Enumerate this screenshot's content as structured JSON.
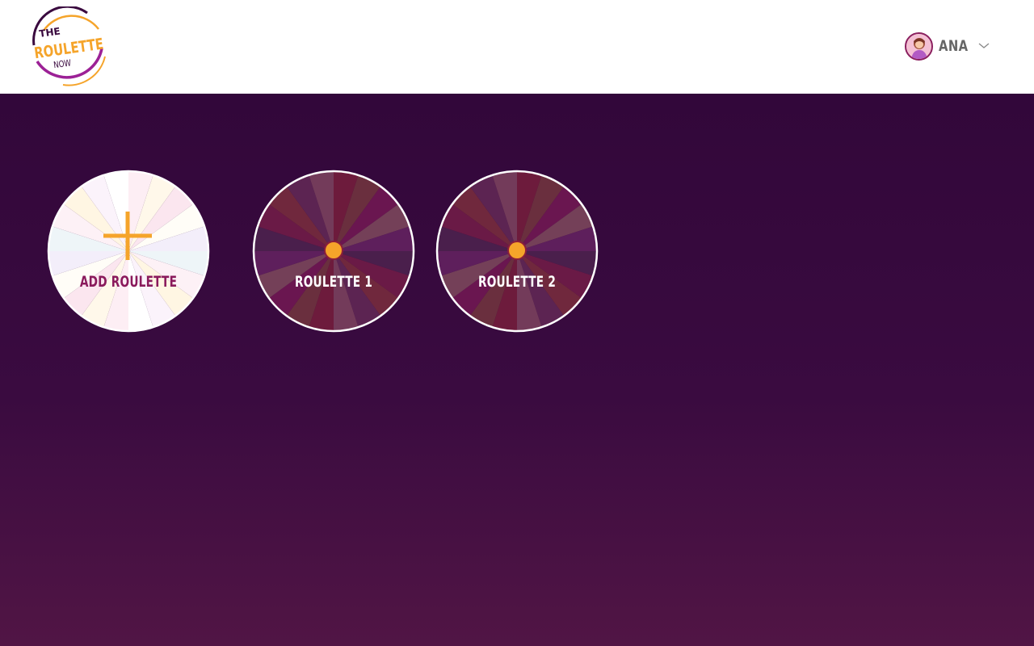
{
  "header": {
    "logo": {
      "line1": "THE",
      "line2": "ROULETTE",
      "line3": "NOW"
    },
    "user": {
      "name": "ANA",
      "avatar_icon": "user-avatar-icon",
      "menu_icon": "chevron-down-icon"
    }
  },
  "roulettes": {
    "add": {
      "label": "ADD ROULETTE",
      "icon": "plus-icon"
    },
    "items": [
      {
        "label": "ROULETTE 1"
      },
      {
        "label": "ROULETTE 2"
      }
    ]
  },
  "colors": {
    "brand_dark": "#32073a",
    "accent_orange": "#f5a42a",
    "accent_magenta": "#9c2196",
    "text_dark_magenta": "#8a1a5c"
  }
}
